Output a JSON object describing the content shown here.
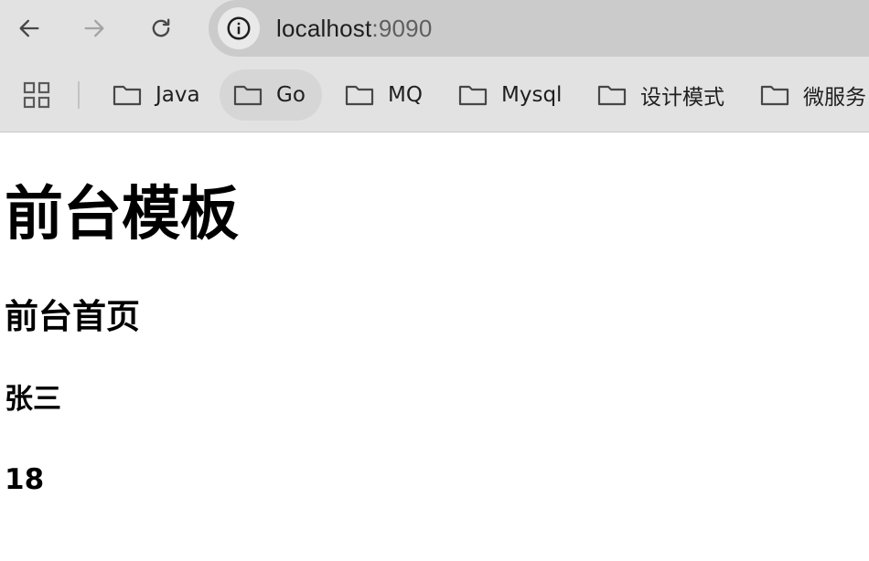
{
  "browser": {
    "url_host": "localhost",
    "url_port": ":9090",
    "bookmarks": [
      {
        "label": "Java",
        "icon": "folder-icon"
      },
      {
        "label": "Go",
        "icon": "folder-icon"
      },
      {
        "label": "MQ",
        "icon": "folder-icon"
      },
      {
        "label": "Mysql",
        "icon": "folder-icon"
      },
      {
        "label": "设计模式",
        "icon": "folder-icon"
      },
      {
        "label": "微服务",
        "icon": "folder-icon"
      }
    ]
  },
  "page": {
    "title": "前台模板",
    "subtitle": "前台首页",
    "name": "张三",
    "age": "18"
  }
}
